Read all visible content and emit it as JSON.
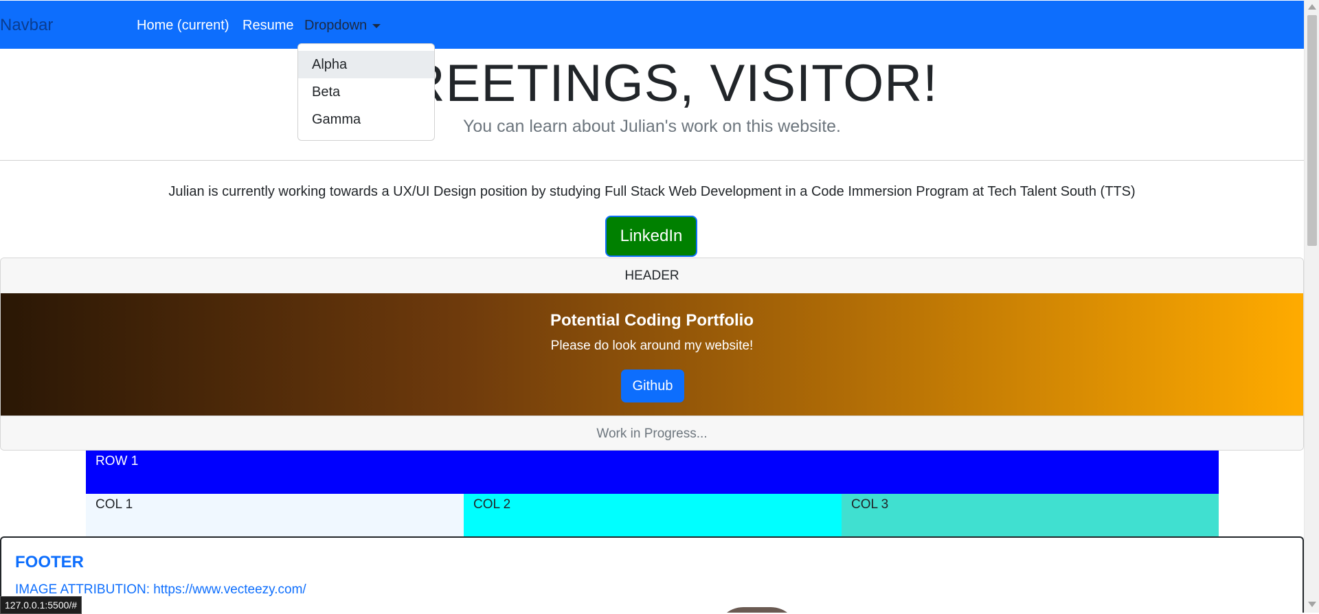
{
  "navbar": {
    "brand": "Navbar",
    "links": [
      {
        "label": "Home (current)"
      },
      {
        "label": "Resume"
      },
      {
        "label": "Dropdown"
      }
    ],
    "dropdown_items": [
      "Alpha",
      "Beta",
      "Gamma"
    ],
    "background_color": "#0d6efd"
  },
  "hero": {
    "title": "GREETINGS, VISITOR!",
    "subtitle": "You can learn about Julian's work on this website."
  },
  "intro": {
    "text": "Julian is currently working towards a UX/UI Design position by studying Full Stack Web Development in a Code Immersion Program at Tech Talent South (TTS)",
    "linkedin_label": "LinkedIn",
    "linkedin_color": "#008000"
  },
  "card": {
    "header": "HEADER",
    "title": "Potential Coding Portfolio",
    "text": "Please do look around my website!",
    "button_label": "Github",
    "footer": "Work in Progress..."
  },
  "grid": {
    "row_label": "ROW 1",
    "row_color": "#0000ff",
    "columns": [
      {
        "label": "COL 1",
        "color": "#f0f8ff"
      },
      {
        "label": "COL 2",
        "color": "#00ffff"
      },
      {
        "label": "COL 3",
        "color": "#40e0d0"
      }
    ]
  },
  "footer": {
    "title": "FOOTER",
    "attribution": "IMAGE ATTRIBUTION: https://www.vecteezy.com/"
  },
  "status_bar": {
    "url": "127.0.0.1:5500/#"
  }
}
